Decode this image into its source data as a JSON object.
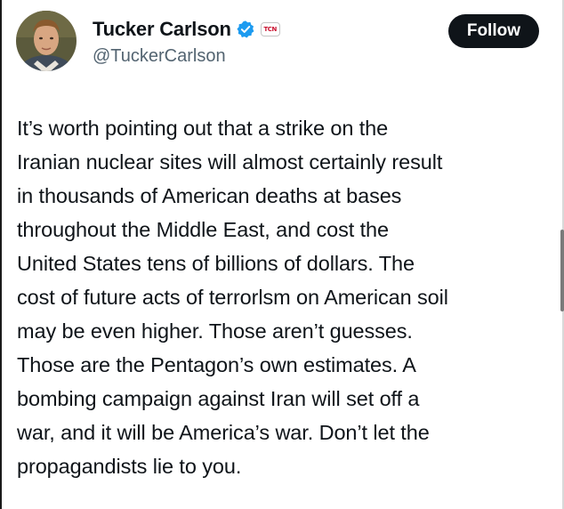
{
  "author": {
    "display_name": "Tucker Carlson",
    "handle": "@TuckerCarlson",
    "verified": true,
    "affiliate_badge_text": "TCN",
    "verified_color": "#1d9bf0"
  },
  "actions": {
    "follow_label": "Follow"
  },
  "tweet": {
    "lines": [
      "It’s worth pointing out that a strike on the",
      "Iranian nuclear sites will almost certainly result",
      "in thousands of American deaths at bases",
      "throughout the Middle East, and cost the",
      "United States tens of billions of dollars. The",
      "cost of future acts of terrorlsm on American soil",
      "may be even higher. Those aren’t guesses.",
      "Those are the Pentagon’s own estimates. A",
      "bombing campaign against Iran will set off a",
      "war, and it will be America’s war. Don’t let the",
      "propagandists lie to you."
    ]
  }
}
